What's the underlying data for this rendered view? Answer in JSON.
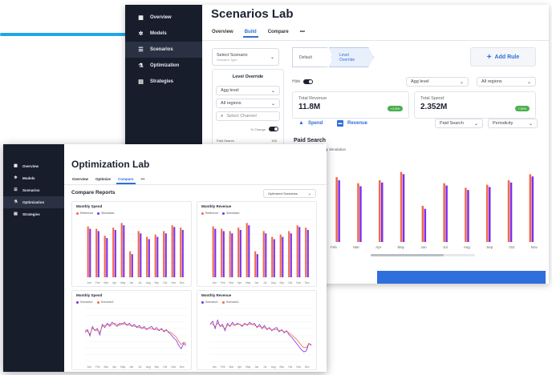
{
  "colors": {
    "sidebar": "#171d2b",
    "accent": "#2f6fdb",
    "series_orange": "#ef6a4a",
    "series_purple": "#7b2ff0",
    "positive_badge": "#4caf50",
    "top_line": "#21a6e6"
  },
  "scenarios_lab": {
    "title": "Scenarios Lab",
    "sidebar": [
      {
        "label": "Overview",
        "icon": "grid-icon"
      },
      {
        "label": "Models",
        "icon": "gear-icon"
      },
      {
        "label": "Scenarios",
        "icon": "list-icon",
        "active": true
      },
      {
        "label": "Optimization",
        "icon": "flask-icon"
      },
      {
        "label": "Strategies",
        "icon": "doc-icon"
      }
    ],
    "tabs": [
      "Overview",
      "Build",
      "Compare",
      "•••"
    ],
    "active_tab": "Build",
    "select_scenario": {
      "label": "Select Scenario",
      "sub": "Scenario Type"
    },
    "steps": [
      "Default",
      "Level",
      "Override"
    ],
    "add_rule": "Add Rule",
    "level_override": {
      "title": "Level Override",
      "agg_level": "Agg level",
      "region": "All regions",
      "channel_placeholder": "Select Channel",
      "pct_change": "% Change",
      "slider_label": "Paid Search",
      "slider_value": "100"
    },
    "filters": {
      "toggle_label": "Hide",
      "agg_level": "Agg level",
      "region": "All regions",
      "channel": "Paid Search",
      "periodicity": "Periodicity"
    },
    "kpis": [
      {
        "label": "Total Revenue",
        "value": "11.8M",
        "badge": "+1.5%"
      },
      {
        "label": "Total Spend",
        "value": "2.352M",
        "badge": "+15%"
      }
    ],
    "metrics": [
      "Spend",
      "Revenue"
    ],
    "chart": {
      "title": "Paid Search",
      "legend": [
        "Simulation"
      ],
      "months": [
        "Feb",
        "Mar",
        "Apr",
        "May",
        "Jun",
        "Jul",
        "Aug",
        "Sep",
        "Oct",
        "Nov"
      ]
    }
  },
  "optimization_lab": {
    "title": "Optimization Lab",
    "sidebar": [
      {
        "label": "Overview",
        "icon": "grid-icon"
      },
      {
        "label": "Models",
        "icon": "gear-icon"
      },
      {
        "label": "Scenarios",
        "icon": "list-icon"
      },
      {
        "label": "Optimization",
        "icon": "flask-icon",
        "active": true
      },
      {
        "label": "Strategies",
        "icon": "doc-icon"
      }
    ],
    "tabs": [
      "Overview",
      "Optimize",
      "Compare",
      "•••"
    ],
    "active_tab": "Compare",
    "section_title": "Compare Reports",
    "scenario_select": "Optimized Scenarios",
    "cards": [
      {
        "title": "Monthly Spend",
        "legend": [
          "Reference",
          "Simulation"
        ]
      },
      {
        "title": "Monthly Revenue",
        "legend": [
          "Reference",
          "Simulation"
        ]
      },
      {
        "title": "Monthly Spend",
        "legend": [
          "Scenario1",
          "Scenario2"
        ]
      },
      {
        "title": "Monthly Revenue",
        "legend": [
          "Scenario1",
          "Scenario2"
        ]
      }
    ],
    "months": [
      "Jan",
      "Feb",
      "Mar",
      "Apr",
      "May",
      "Jun",
      "Jul",
      "Aug",
      "Sep",
      "Oct",
      "Nov",
      "Dec"
    ]
  },
  "chart_data": [
    {
      "type": "bar",
      "title": "Paid Search",
      "categories": [
        "Feb",
        "Mar",
        "Apr",
        "May",
        "Jun",
        "Jul",
        "Aug",
        "Sep",
        "Oct",
        "Nov"
      ],
      "series": [
        {
          "name": "Reference",
          "values": [
            0.86,
            0.78,
            0.82,
            0.93,
            0.48,
            0.78,
            0.72,
            0.76,
            0.82,
            0.9
          ]
        },
        {
          "name": "Simulation",
          "values": [
            0.82,
            0.74,
            0.79,
            0.9,
            0.44,
            0.75,
            0.69,
            0.73,
            0.79,
            0.87
          ]
        }
      ]
    },
    {
      "type": "bar",
      "title": "Monthly Spend",
      "categories": [
        "Jan",
        "Feb",
        "Mar",
        "Apr",
        "May",
        "Jun",
        "Jul",
        "Aug",
        "Sep",
        "Oct",
        "Nov",
        "Dec"
      ],
      "series": [
        {
          "name": "Reference",
          "values": [
            0.88,
            0.84,
            0.72,
            0.86,
            0.94,
            0.45,
            0.8,
            0.7,
            0.74,
            0.8,
            0.9,
            0.86
          ]
        },
        {
          "name": "Simulation",
          "values": [
            0.84,
            0.8,
            0.68,
            0.82,
            0.9,
            0.4,
            0.76,
            0.66,
            0.7,
            0.76,
            0.87,
            0.82
          ]
        }
      ]
    },
    {
      "type": "bar",
      "title": "Monthly Revenue",
      "categories": [
        "Jan",
        "Feb",
        "Mar",
        "Apr",
        "May",
        "Jun",
        "Jul",
        "Aug",
        "Sep",
        "Oct",
        "Nov",
        "Dec"
      ],
      "series": [
        {
          "name": "Reference",
          "values": [
            0.88,
            0.84,
            0.8,
            0.86,
            0.94,
            0.45,
            0.8,
            0.7,
            0.74,
            0.8,
            0.9,
            0.86
          ]
        },
        {
          "name": "Simulation",
          "values": [
            0.84,
            0.8,
            0.76,
            0.82,
            0.9,
            0.4,
            0.76,
            0.66,
            0.7,
            0.76,
            0.87,
            0.82
          ]
        }
      ]
    },
    {
      "type": "line",
      "title": "Monthly Spend",
      "series": [
        {
          "name": "Scenario1",
          "values": [
            0.55,
            0.6,
            0.48,
            0.66,
            0.58,
            0.62,
            0.5,
            0.7,
            0.64,
            0.72,
            0.68,
            0.74,
            0.7,
            0.66,
            0.72,
            0.7,
            0.74,
            0.68,
            0.72,
            0.66,
            0.7,
            0.64,
            0.68,
            0.62,
            0.66,
            0.6,
            0.64,
            0.66,
            0.6,
            0.64,
            0.58,
            0.62,
            0.56,
            0.6,
            0.54,
            0.5,
            0.44,
            0.4,
            0.3,
            0.24,
            0.34,
            0.3
          ]
        },
        {
          "name": "Scenario2",
          "values": [
            0.6,
            0.56,
            0.52,
            0.62,
            0.6,
            0.58,
            0.55,
            0.66,
            0.68,
            0.7,
            0.66,
            0.7,
            0.72,
            0.7,
            0.68,
            0.72,
            0.7,
            0.7,
            0.68,
            0.68,
            0.66,
            0.66,
            0.64,
            0.64,
            0.62,
            0.62,
            0.62,
            0.62,
            0.6,
            0.6,
            0.6,
            0.6,
            0.58,
            0.58,
            0.56,
            0.54,
            0.5,
            0.46,
            0.38,
            0.32,
            0.36,
            0.34
          ]
        }
      ]
    },
    {
      "type": "line",
      "title": "Monthly Revenue",
      "series": [
        {
          "name": "Scenario1",
          "values": [
            0.7,
            0.76,
            0.62,
            0.78,
            0.66,
            0.7,
            0.58,
            0.72,
            0.66,
            0.74,
            0.68,
            0.72,
            0.7,
            0.66,
            0.72,
            0.68,
            0.74,
            0.7,
            0.72,
            0.64,
            0.7,
            0.62,
            0.68,
            0.6,
            0.64,
            0.58,
            0.62,
            0.64,
            0.56,
            0.6,
            0.54,
            0.58,
            0.5,
            0.46,
            0.4,
            0.34,
            0.28,
            0.22,
            0.18,
            0.2,
            0.34,
            0.3
          ]
        },
        {
          "name": "Scenario2",
          "values": [
            0.72,
            0.7,
            0.66,
            0.72,
            0.68,
            0.66,
            0.62,
            0.68,
            0.68,
            0.7,
            0.68,
            0.7,
            0.7,
            0.68,
            0.7,
            0.7,
            0.7,
            0.7,
            0.68,
            0.66,
            0.66,
            0.64,
            0.64,
            0.62,
            0.62,
            0.6,
            0.6,
            0.6,
            0.58,
            0.58,
            0.56,
            0.56,
            0.54,
            0.5,
            0.46,
            0.42,
            0.36,
            0.3,
            0.26,
            0.26,
            0.34,
            0.32
          ]
        }
      ]
    }
  ]
}
